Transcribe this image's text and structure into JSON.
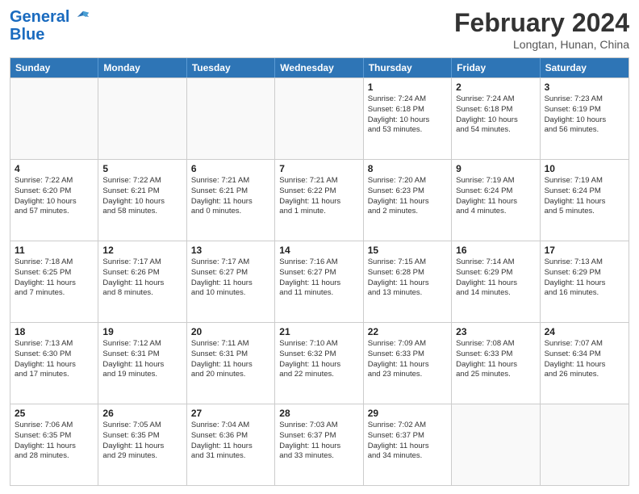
{
  "header": {
    "logo_line1": "General",
    "logo_line2": "Blue",
    "main_title": "February 2024",
    "subtitle": "Longtan, Hunan, China"
  },
  "calendar": {
    "days_of_week": [
      "Sunday",
      "Monday",
      "Tuesday",
      "Wednesday",
      "Thursday",
      "Friday",
      "Saturday"
    ],
    "rows": [
      [
        {
          "day": "",
          "info": ""
        },
        {
          "day": "",
          "info": ""
        },
        {
          "day": "",
          "info": ""
        },
        {
          "day": "",
          "info": ""
        },
        {
          "day": "1",
          "info": "Sunrise: 7:24 AM\nSunset: 6:18 PM\nDaylight: 10 hours\nand 53 minutes."
        },
        {
          "day": "2",
          "info": "Sunrise: 7:24 AM\nSunset: 6:18 PM\nDaylight: 10 hours\nand 54 minutes."
        },
        {
          "day": "3",
          "info": "Sunrise: 7:23 AM\nSunset: 6:19 PM\nDaylight: 10 hours\nand 56 minutes."
        }
      ],
      [
        {
          "day": "4",
          "info": "Sunrise: 7:22 AM\nSunset: 6:20 PM\nDaylight: 10 hours\nand 57 minutes."
        },
        {
          "day": "5",
          "info": "Sunrise: 7:22 AM\nSunset: 6:21 PM\nDaylight: 10 hours\nand 58 minutes."
        },
        {
          "day": "6",
          "info": "Sunrise: 7:21 AM\nSunset: 6:21 PM\nDaylight: 11 hours\nand 0 minutes."
        },
        {
          "day": "7",
          "info": "Sunrise: 7:21 AM\nSunset: 6:22 PM\nDaylight: 11 hours\nand 1 minute."
        },
        {
          "day": "8",
          "info": "Sunrise: 7:20 AM\nSunset: 6:23 PM\nDaylight: 11 hours\nand 2 minutes."
        },
        {
          "day": "9",
          "info": "Sunrise: 7:19 AM\nSunset: 6:24 PM\nDaylight: 11 hours\nand 4 minutes."
        },
        {
          "day": "10",
          "info": "Sunrise: 7:19 AM\nSunset: 6:24 PM\nDaylight: 11 hours\nand 5 minutes."
        }
      ],
      [
        {
          "day": "11",
          "info": "Sunrise: 7:18 AM\nSunset: 6:25 PM\nDaylight: 11 hours\nand 7 minutes."
        },
        {
          "day": "12",
          "info": "Sunrise: 7:17 AM\nSunset: 6:26 PM\nDaylight: 11 hours\nand 8 minutes."
        },
        {
          "day": "13",
          "info": "Sunrise: 7:17 AM\nSunset: 6:27 PM\nDaylight: 11 hours\nand 10 minutes."
        },
        {
          "day": "14",
          "info": "Sunrise: 7:16 AM\nSunset: 6:27 PM\nDaylight: 11 hours\nand 11 minutes."
        },
        {
          "day": "15",
          "info": "Sunrise: 7:15 AM\nSunset: 6:28 PM\nDaylight: 11 hours\nand 13 minutes."
        },
        {
          "day": "16",
          "info": "Sunrise: 7:14 AM\nSunset: 6:29 PM\nDaylight: 11 hours\nand 14 minutes."
        },
        {
          "day": "17",
          "info": "Sunrise: 7:13 AM\nSunset: 6:29 PM\nDaylight: 11 hours\nand 16 minutes."
        }
      ],
      [
        {
          "day": "18",
          "info": "Sunrise: 7:13 AM\nSunset: 6:30 PM\nDaylight: 11 hours\nand 17 minutes."
        },
        {
          "day": "19",
          "info": "Sunrise: 7:12 AM\nSunset: 6:31 PM\nDaylight: 11 hours\nand 19 minutes."
        },
        {
          "day": "20",
          "info": "Sunrise: 7:11 AM\nSunset: 6:31 PM\nDaylight: 11 hours\nand 20 minutes."
        },
        {
          "day": "21",
          "info": "Sunrise: 7:10 AM\nSunset: 6:32 PM\nDaylight: 11 hours\nand 22 minutes."
        },
        {
          "day": "22",
          "info": "Sunrise: 7:09 AM\nSunset: 6:33 PM\nDaylight: 11 hours\nand 23 minutes."
        },
        {
          "day": "23",
          "info": "Sunrise: 7:08 AM\nSunset: 6:33 PM\nDaylight: 11 hours\nand 25 minutes."
        },
        {
          "day": "24",
          "info": "Sunrise: 7:07 AM\nSunset: 6:34 PM\nDaylight: 11 hours\nand 26 minutes."
        }
      ],
      [
        {
          "day": "25",
          "info": "Sunrise: 7:06 AM\nSunset: 6:35 PM\nDaylight: 11 hours\nand 28 minutes."
        },
        {
          "day": "26",
          "info": "Sunrise: 7:05 AM\nSunset: 6:35 PM\nDaylight: 11 hours\nand 29 minutes."
        },
        {
          "day": "27",
          "info": "Sunrise: 7:04 AM\nSunset: 6:36 PM\nDaylight: 11 hours\nand 31 minutes."
        },
        {
          "day": "28",
          "info": "Sunrise: 7:03 AM\nSunset: 6:37 PM\nDaylight: 11 hours\nand 33 minutes."
        },
        {
          "day": "29",
          "info": "Sunrise: 7:02 AM\nSunset: 6:37 PM\nDaylight: 11 hours\nand 34 minutes."
        },
        {
          "day": "",
          "info": ""
        },
        {
          "day": "",
          "info": ""
        }
      ]
    ]
  }
}
